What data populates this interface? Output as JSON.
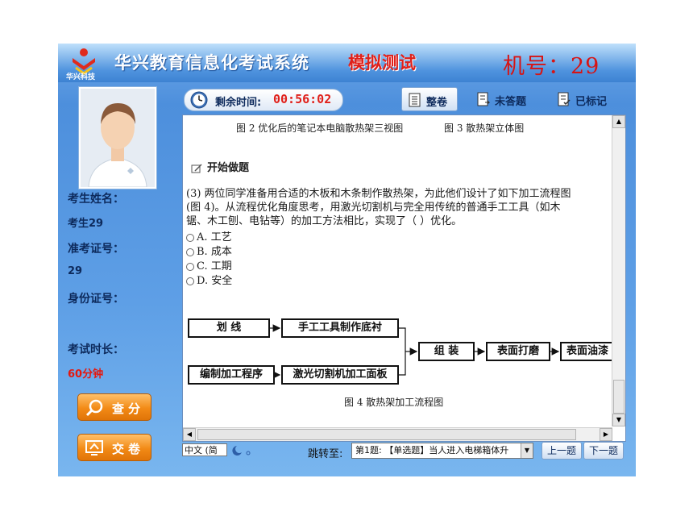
{
  "header": {
    "logo_text": "华兴科技",
    "title": "华兴教育信息化考试系统",
    "title_mode": "模拟测试",
    "machine": "机号：29"
  },
  "sidebar": {
    "name_label": "考生姓名：",
    "name_value": "考生29",
    "id_label": "准考证号：",
    "id_value": "29",
    "idcard_label": "身份证号：",
    "duration_label": "考试时长：",
    "duration_value": "60分钟",
    "score_button": "查分",
    "submit_button": "交卷"
  },
  "toolbar": {
    "timer_label": "剩余时间:",
    "timer_value": "00:56:02",
    "whole_paper": "整卷",
    "unanswered": "未答题",
    "marked": "已标记"
  },
  "content": {
    "caption_fig2": "图 2 优化后的笔记本电脑散热架三视图",
    "caption_fig3": "图 3 散热架立体图",
    "start_label": "开始做题",
    "question_lines": [
      "(3) 两位同学准备用合适的木板和木条制作散热架，为此他们设计了如下加工流程图",
      "(图 4)。从流程优化角度思考，用激光切割机与完全用传统的普通手工工具（如木",
      "锯、木工刨、电钻等）的加工方法相比，实现了（  ）优化。"
    ],
    "options": [
      "A. 工艺",
      "B. 成本",
      "C. 工期",
      "D. 安全"
    ],
    "flowchart": {
      "box_draw": "划    线",
      "box_manual": "手工工具制作底衬",
      "box_program": "编制加工程序",
      "box_laser": "激光切割机加工面板",
      "box_assemble": "组    装",
      "box_polish": "表面打磨",
      "box_paint": "表面油漆"
    },
    "caption_fig4": "图 4 散热架加工流程图"
  },
  "bottom": {
    "ime_label": "中文 (简",
    "jump_label": "跳转至:",
    "jump_value": "第1题: 【单选题】当人进入电梯箱体升",
    "prev_button": "上一题",
    "next_button": "下一题"
  },
  "colors": {
    "accent_blue": "#4d8fdc",
    "timer_red": "#e0201a",
    "button_orange": "#f28a16"
  }
}
